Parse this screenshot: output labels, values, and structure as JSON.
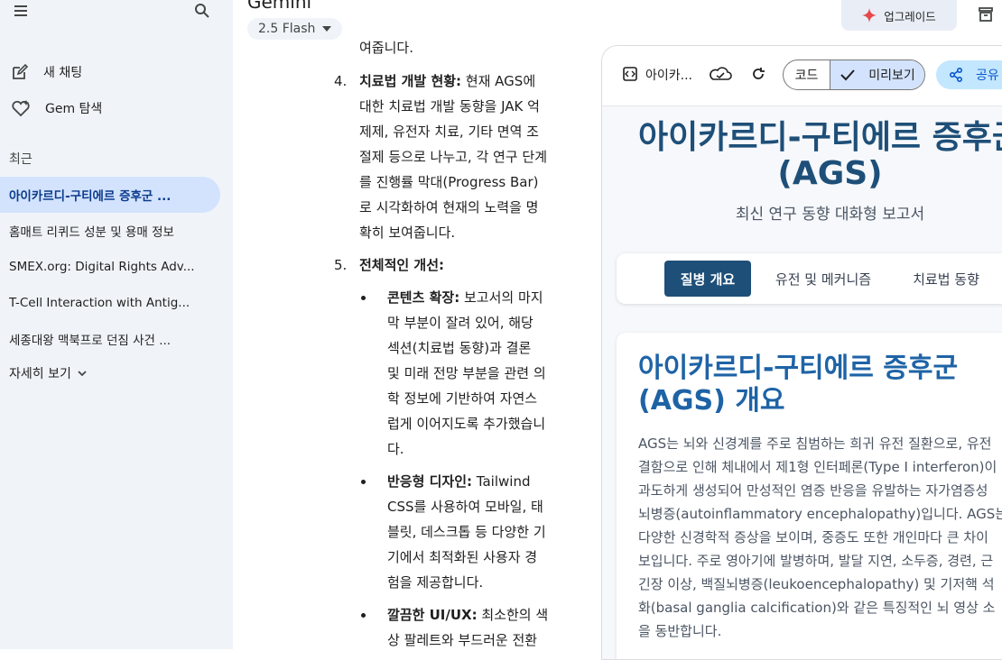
{
  "app": {
    "title": "Gemini",
    "model": "2.5 Flash"
  },
  "sidebar": {
    "new_chat": "새 채팅",
    "gem_explore": "Gem 탐색",
    "recent_label": "최근",
    "recent": [
      "아이카르디-구티에르 증후군 ...",
      "홈매트 리퀴드 성분 및 용매 정보",
      "SMEX.org: Digital Rights Adv...",
      "T-Cell Interaction with Antig...",
      "세종대왕 맥북프로 던짐 사건 ..."
    ],
    "more": "자세히 보기"
  },
  "chat": {
    "fragment": "여줍니다.",
    "item4": {
      "num": "4.",
      "bold": "치료법 개발 현황:",
      "lines": [
        " 현재 AGS에",
        "대한 치료법 개발 동향을 JAK 억",
        "제제, 유전자 치료, 기타 면역 조",
        "절제 등으로 나누고, 각 연구 단계",
        "를 진행률 막대(Progress Bar)",
        "로 시각화하여 현재의 노력을 명",
        "확히 보여줍니다."
      ]
    },
    "item5": {
      "num": "5.",
      "bold": "전체적인 개선:"
    },
    "bullets": [
      {
        "bold": "콘텐츠 확장:",
        "lines": [
          " 보고서의 마지",
          "막 부분이 잘려 있어, 해당",
          "섹션(치료법 동향)과 결론",
          "및 미래 전망 부분을 관련 의",
          "학 정보에 기반하여 자연스",
          "럽게 이어지도록 추가했습니",
          "다."
        ]
      },
      {
        "bold": "반응형 디자인:",
        "lines": [
          " Tailwind",
          "CSS를 사용하여 모바일, 태",
          "블릿, 데스크톱 등 다양한 기",
          "기에서 최적화된 사용자 경",
          "험을 제공합니다."
        ]
      },
      {
        "bold": "깔끔한 UI/UX:",
        "lines": [
          " 최소한의 색",
          "상 팔레트와 부드러운 전환"
        ]
      }
    ]
  },
  "topbar": {
    "upgrade": "업그레이드"
  },
  "canvas": {
    "doc_name": "아이카...",
    "code_label": "코드",
    "preview_label": "미리보기",
    "share_label": "공유",
    "title_line1": "아이카르디-구티에르 증후군",
    "title_line2": "(AGS)",
    "subtitle": "최신 연구 동향 대화형 보고서",
    "tabs": [
      "질병 개요",
      "유전 및 메커니즘",
      "치료법 동향"
    ],
    "section_title_1": "아이카르디-구티에르 증후군",
    "section_title_2": "(AGS) 개요",
    "body_lines": [
      "AGS는 뇌와 신경계를 주로 침범하는 희귀 유전 질환으로, 유전",
      "결함으로 인해 체내에서 제1형 인터페론(Type I interferon)이",
      "과도하게 생성되어 만성적인 염증 반응을 유발하는 자가염증성",
      "뇌병증(autoinflammatory encephalopathy)입니다. AGS는",
      "다양한 신경학적 증상을 보이며, 중증도 또한 개인마다 큰 차이",
      "보입니다. 주로 영아기에 발병하며, 발달 지연, 소두증, 경련, 근",
      "긴장 이상, 백질뇌병증(leukoencephalopathy) 및 기저핵 석",
      "화(basal ganglia calcification)와 같은 특징적인 뇌 영상 소",
      "을 동반합니다."
    ]
  },
  "colors": {
    "sidebar_bg": "#f0f4f9",
    "active_item": "#d3e3fd",
    "accent_navy": "#1e4f78",
    "accent_blue": "#1e63a6",
    "share_bg": "#c2e7ff"
  }
}
